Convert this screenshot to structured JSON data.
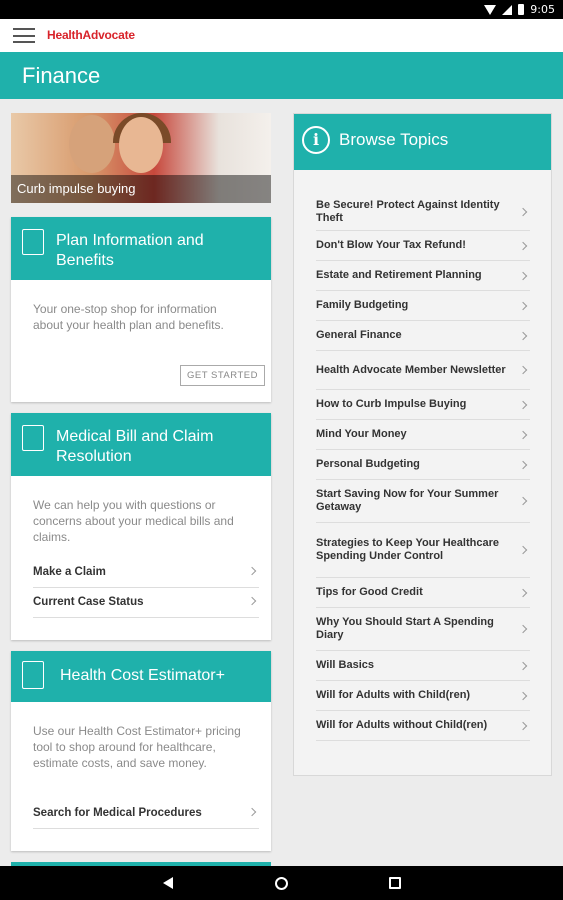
{
  "status_bar": {
    "time": "9:05"
  },
  "app_bar": {
    "logo": "HealthAdvocate"
  },
  "page": {
    "title": "Finance"
  },
  "hero": {
    "caption": "Curb impulse buying"
  },
  "cards": {
    "plan": {
      "title": "Plan Information and Benefits",
      "description": "Your one-stop shop for information about your health plan and benefits.",
      "button": "GET STARTED"
    },
    "medical": {
      "title": "Medical Bill and Claim Resolution",
      "description": "We can help you with questions or concerns about your medical bills and claims.",
      "links": [
        "Make a Claim",
        "Current Case Status"
      ]
    },
    "cost": {
      "title": "Health Cost Estimator+",
      "description": "Use our Health Cost Estimator+ pricing tool to shop around for healthcare, estimate costs, and save money.",
      "links": [
        "Search for Medical Procedures"
      ]
    }
  },
  "topics": {
    "title": "Browse Topics",
    "items": [
      "Be Secure!  Protect Against Identity Theft",
      "Don't Blow Your Tax Refund!",
      "Estate and Retirement Planning",
      "Family Budgeting",
      "General Finance",
      "Health Advocate Member Newsletter",
      "How to Curb Impulse Buying",
      "Mind Your Money",
      "Personal Budgeting",
      "Start Saving Now for Your Summer Getaway",
      "Strategies to Keep Your Healthcare Spending Under Control",
      "Tips for Good Credit",
      "Why You Should Start A Spending Diary",
      "Will Basics",
      "Will for Adults with Child(ren)",
      "Will for Adults without Child(ren)"
    ]
  }
}
